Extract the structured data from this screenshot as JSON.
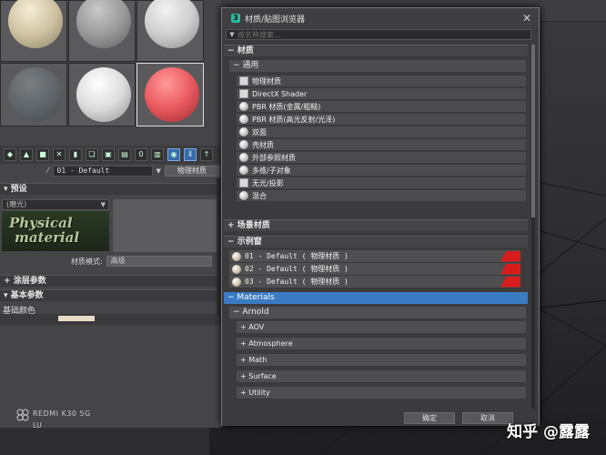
{
  "material_editor": {
    "material_name": "01 - Default",
    "material_type_button": "物理材质",
    "preset_section": "预设",
    "preset_value": "(磨光)",
    "logo_line1": "Physical",
    "logo_line2": "material",
    "material_mode_label": "材质模式:",
    "material_mode_value": "高级",
    "coating_section": "涂层参数",
    "basic_section": "基本参数",
    "base_color_label": "基础颜色"
  },
  "browser": {
    "title": "材质/贴图浏览器",
    "search_placeholder": "按名称搜索...",
    "groups": {
      "materials": "材质",
      "general": "通用",
      "scene_materials": "场景材质",
      "sample_slots": "示例窗",
      "materials_en": "Materials",
      "arnold": "Arnold"
    },
    "general_items": [
      "物理材质",
      "DirectX Shader",
      "PBR 材质(金属/粗糙)",
      "PBR 材质(高光反射/光泽)",
      "双面",
      "壳材质",
      "外部参照材质",
      "多维/子对象",
      "无光/投影",
      "混合"
    ],
    "sample_slots": [
      "01 - Default  ( 物理材质 )",
      "02 - Default  ( 物理材质 )",
      "03 - Default  ( 物理材质 )"
    ],
    "arnold_categories": [
      "AOV",
      "Atmosphere",
      "Math",
      "Surface",
      "Utility"
    ],
    "ok_button": "确定",
    "cancel_button": "取消"
  },
  "overlays": {
    "device_line1": "REDMI K30 5G",
    "device_line2": "LU",
    "watermark": "知乎 @露露"
  },
  "colors": {
    "selected_group": "#3b7bc4",
    "sample_marker": "#d81c1c"
  }
}
